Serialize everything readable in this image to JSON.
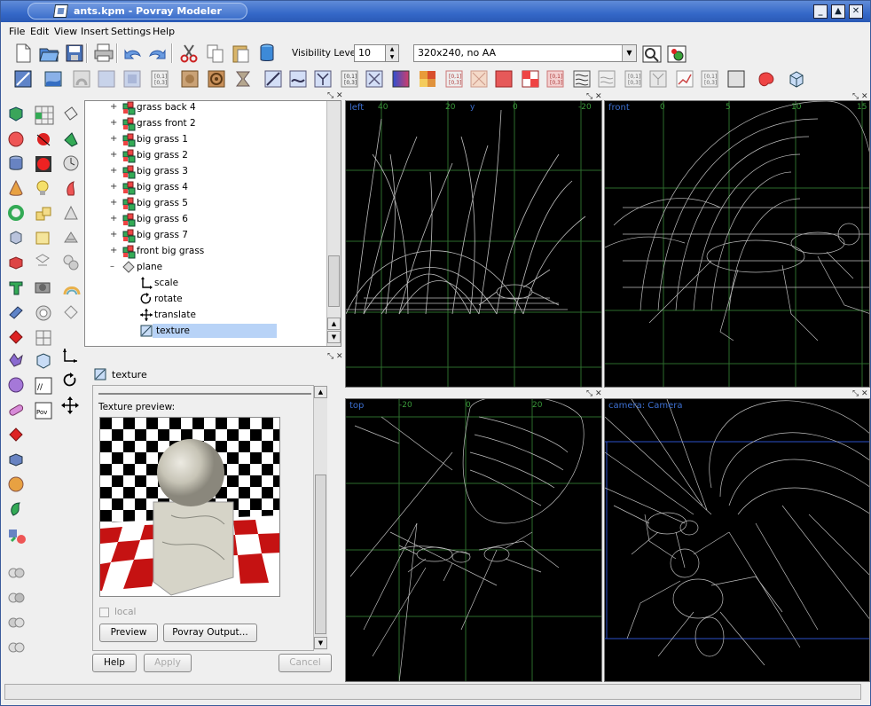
{
  "window": {
    "title": "ants.kpm - Povray Modeler"
  },
  "menu": [
    "File",
    "Edit",
    "View",
    "Insert",
    "Settings",
    "Help"
  ],
  "toolbar": {
    "visibility_label": "Visibility Level:",
    "visibility_value": "10",
    "render_mode": "320x240, no AA"
  },
  "tree": {
    "items": [
      {
        "label": "grass back 4",
        "icon": "object-group-icon"
      },
      {
        "label": "grass front 2",
        "icon": "object-group-icon"
      },
      {
        "label": "big grass 1",
        "icon": "object-group-icon"
      },
      {
        "label": "big grass 2",
        "icon": "object-group-icon"
      },
      {
        "label": "big grass 3",
        "icon": "object-group-icon"
      },
      {
        "label": "big grass 4",
        "icon": "object-group-icon"
      },
      {
        "label": "big grass 5",
        "icon": "object-group-icon"
      },
      {
        "label": "big grass 6",
        "icon": "object-group-icon"
      },
      {
        "label": "big grass 7",
        "icon": "object-group-icon"
      },
      {
        "label": "front big grass",
        "icon": "object-group-icon"
      },
      {
        "label": "plane",
        "icon": "plane-icon"
      },
      {
        "label": "scale",
        "icon": "scale-icon"
      },
      {
        "label": "rotate",
        "icon": "rotate-icon"
      },
      {
        "label": "translate",
        "icon": "translate-icon"
      },
      {
        "label": "texture",
        "icon": "texture-icon",
        "selected": true
      }
    ]
  },
  "properties": {
    "title": "texture",
    "preview_label": "Texture preview:",
    "local_label": "local",
    "preview_button": "Preview",
    "povray_output_button": "Povray Output...",
    "help_button": "Help",
    "apply_button": "Apply",
    "cancel_button": "Cancel"
  },
  "viewports": [
    {
      "label": "left",
      "ticks": [
        "40",
        "20",
        "0",
        "-20"
      ],
      "axis": "y"
    },
    {
      "label": "front",
      "ticks": [
        "0",
        "5",
        "10",
        "15"
      ]
    },
    {
      "label": "top",
      "ticks": [
        "-20",
        "0",
        "20"
      ]
    },
    {
      "label": "camera: Camera"
    }
  ],
  "colors": {
    "accent": "#3468c8",
    "selection": "#b8d3f7",
    "grid": "#2d6b2d"
  }
}
